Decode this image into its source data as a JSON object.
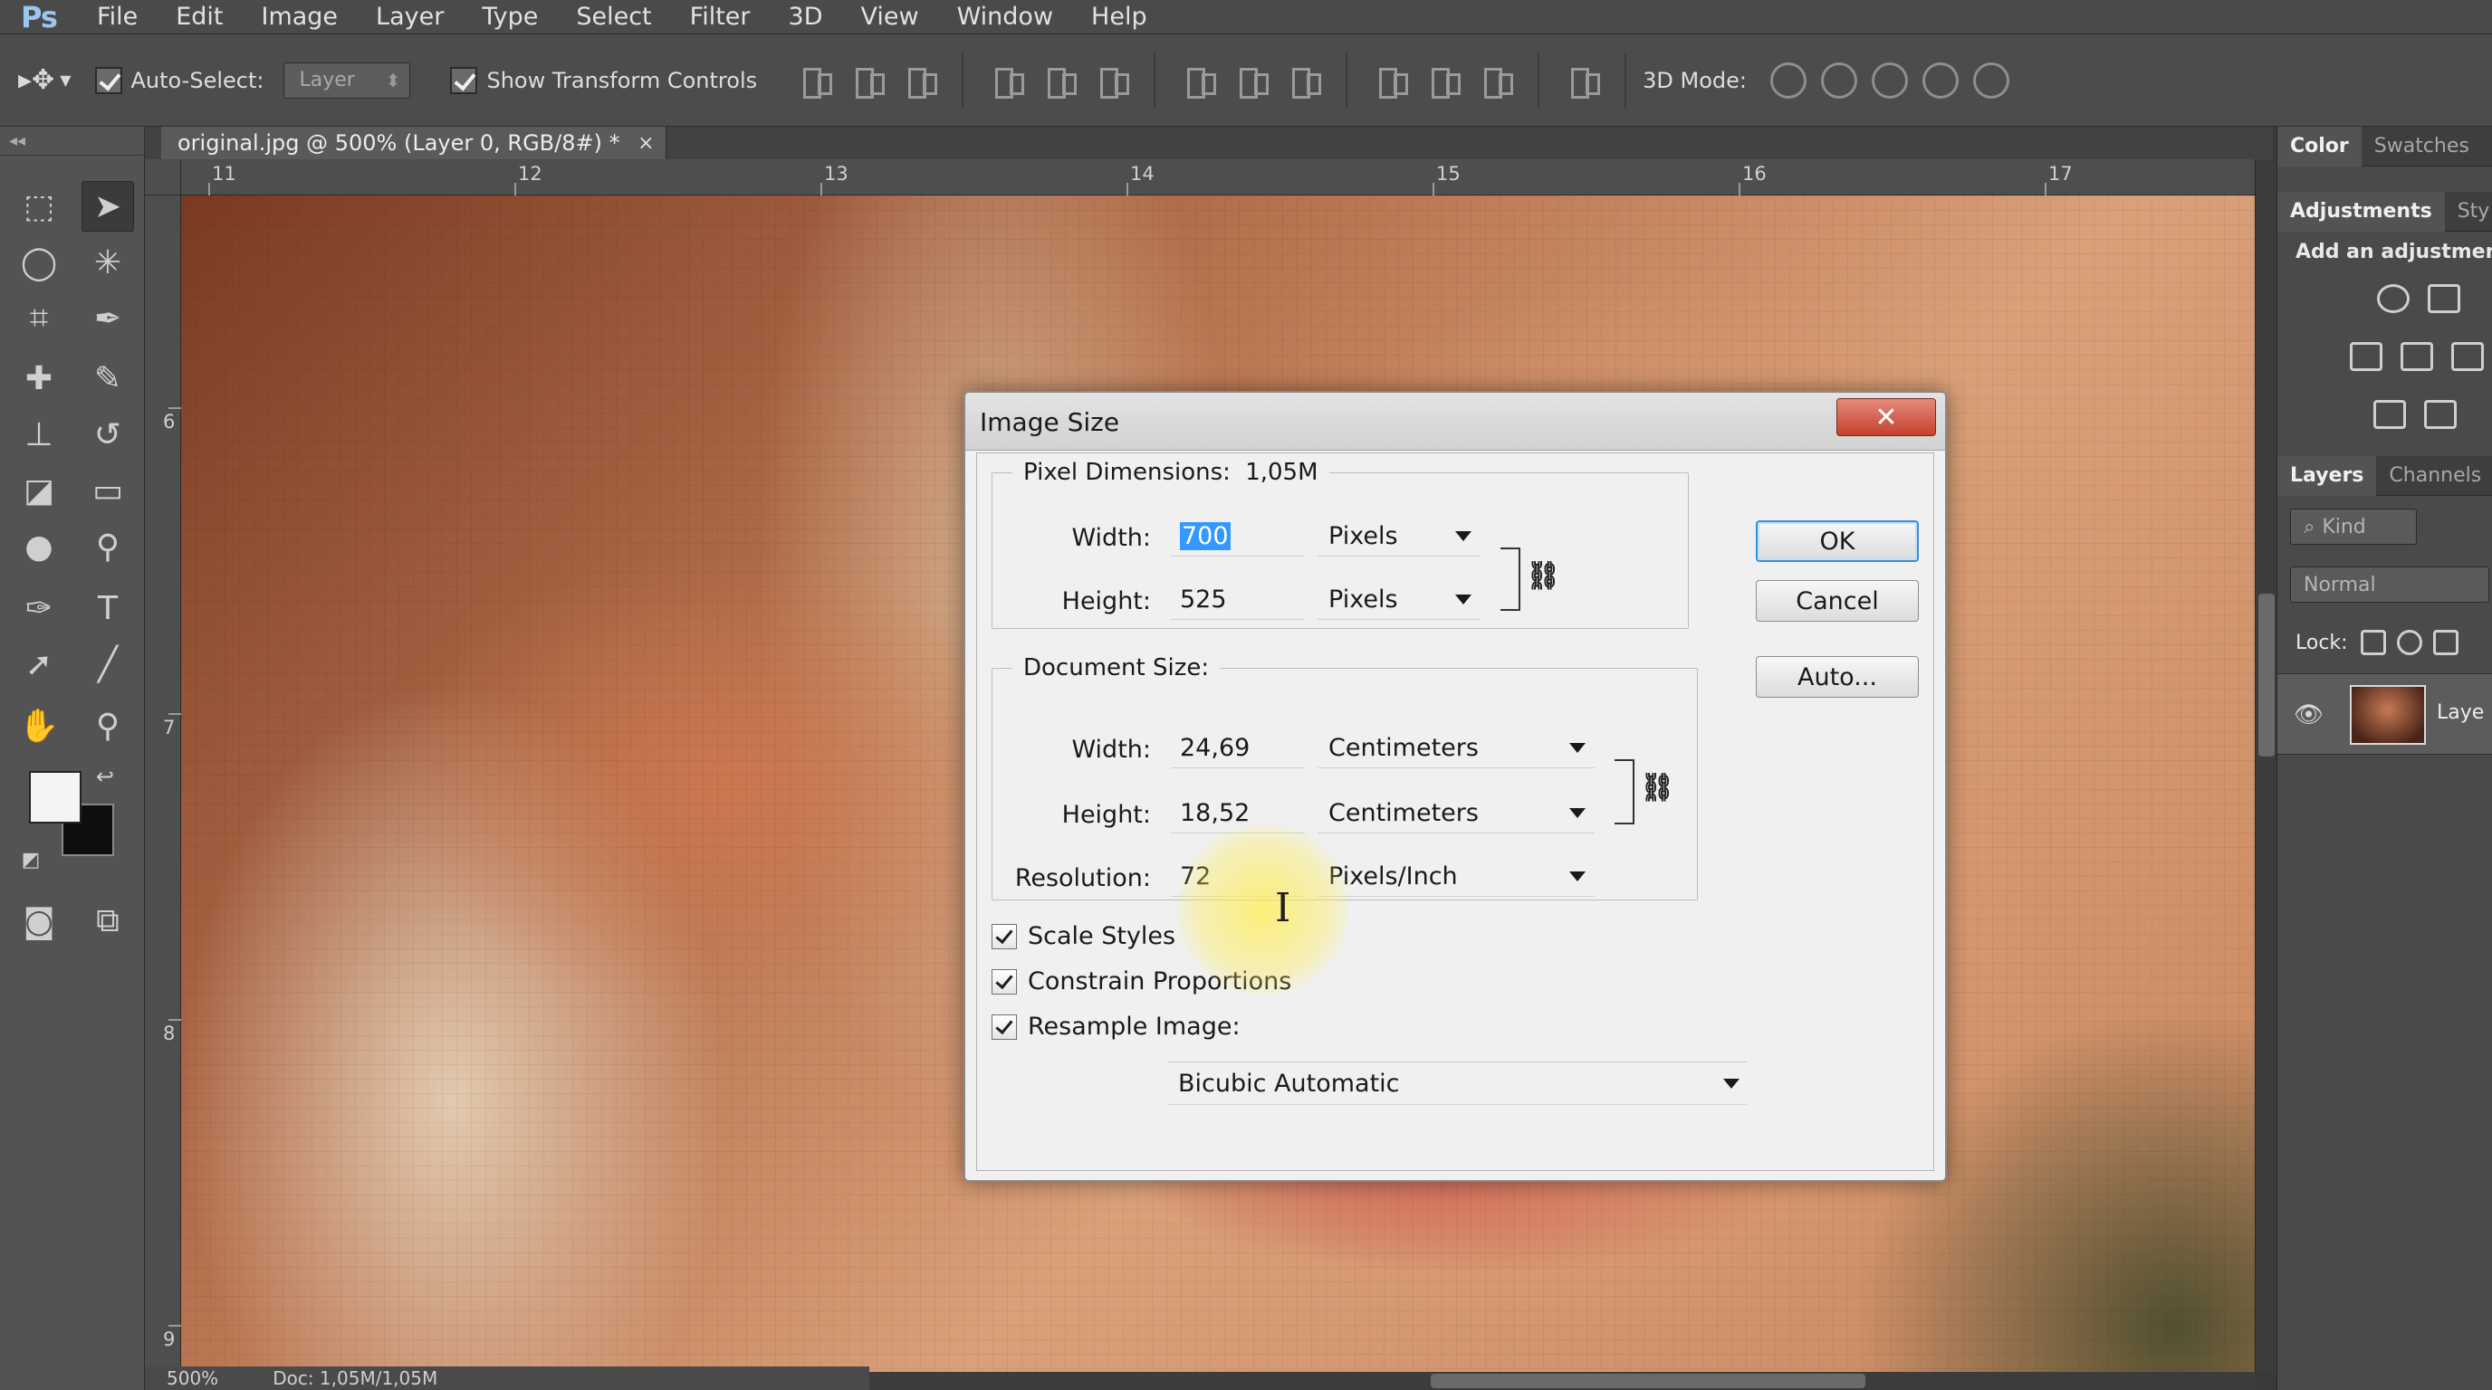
{
  "app": {
    "logo": "Ps",
    "menu": [
      "File",
      "Edit",
      "Image",
      "Layer",
      "Type",
      "Select",
      "Filter",
      "3D",
      "View",
      "Window",
      "Help"
    ]
  },
  "options_bar": {
    "auto_select_label": "Auto-Select:",
    "auto_select_value": "Layer",
    "show_transform_label": "Show Transform Controls",
    "mode3d_label": "3D Mode:"
  },
  "document": {
    "tab_title": "original.jpg @ 500% (Layer 0, RGB/8#) *",
    "close_glyph": "×",
    "ruler_h": [
      "11",
      "12",
      "13",
      "14",
      "15",
      "16",
      "17"
    ],
    "ruler_v": [
      "6",
      "7",
      "8",
      "9"
    ],
    "status_zoom": "500%",
    "status_doc": "Doc: 1,05M/1,05M"
  },
  "panels": {
    "top_tabs": [
      "Color",
      "Swatches"
    ],
    "adj_tabs": [
      "Adjustments",
      "Sty"
    ],
    "adj_hint": "Add an adjustmen",
    "layer_tabs": [
      "Layers",
      "Channels"
    ],
    "kind_label": "Kind",
    "blend_mode": "Normal",
    "lock_label": "Lock:",
    "layer_name": "Laye"
  },
  "dialog": {
    "title": "Image Size",
    "close_glyph": "✕",
    "pixel_dimensions": {
      "legend_label": "Pixel Dimensions:",
      "legend_value": "1,05M",
      "width_label": "Width:",
      "width_value": "700",
      "width_unit": "Pixels",
      "height_label": "Height:",
      "height_value": "525",
      "height_unit": "Pixels"
    },
    "document_size": {
      "legend_label": "Document Size:",
      "width_label": "Width:",
      "width_value": "24,69",
      "width_unit": "Centimeters",
      "height_label": "Height:",
      "height_value": "18,52",
      "height_unit": "Centimeters",
      "resolution_label": "Resolution:",
      "resolution_value": "72",
      "resolution_unit": "Pixels/Inch"
    },
    "options": {
      "scale_styles": "Scale Styles",
      "constrain_proportions": "Constrain Proportions",
      "resample_image": "Resample Image:",
      "resample_method": "Bicubic Automatic"
    },
    "buttons": {
      "ok": "OK",
      "cancel": "Cancel",
      "auto": "Auto..."
    }
  }
}
